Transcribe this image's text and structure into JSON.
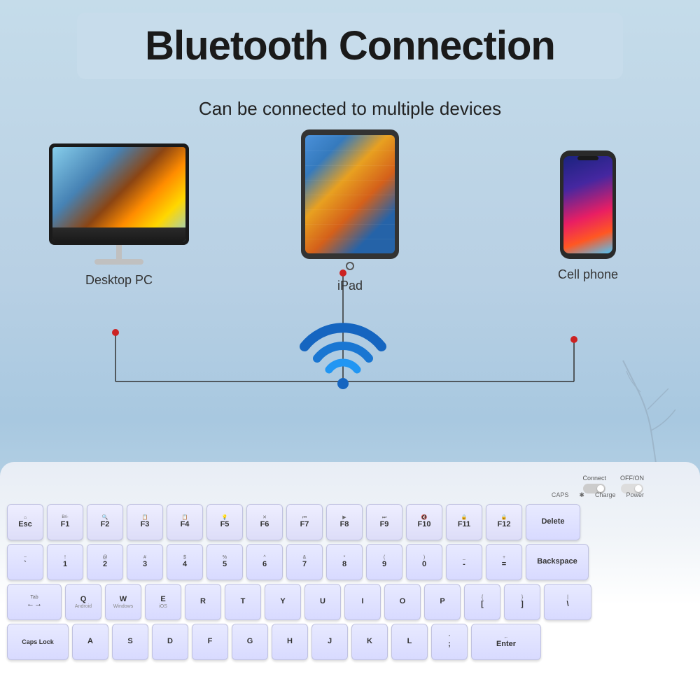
{
  "page": {
    "background_color": "#b8d4e8",
    "title": "Bluetooth Connection",
    "subtitle": "Can be connected to multiple devices"
  },
  "devices": [
    {
      "id": "desktop",
      "label": "Desktop PC"
    },
    {
      "id": "ipad",
      "label": "iPad"
    },
    {
      "id": "phone",
      "label": "Cell phone"
    }
  ],
  "indicators": {
    "connect_label": "Connect",
    "offon_label": "OFF/ON",
    "caps_label": "CAPS",
    "bt_label": "✱",
    "charge_label": "Charge",
    "power_label": "Power"
  },
  "keyboard": {
    "row1": [
      {
        "top": "⌂",
        "main": "Esc",
        "sub": ""
      },
      {
        "top": "Bri-",
        "main": "F1",
        "sub": ""
      },
      {
        "top": "🔍",
        "main": "F2",
        "sub": ""
      },
      {
        "top": "📋",
        "main": "F3",
        "sub": ""
      },
      {
        "top": "📋",
        "main": "F4",
        "sub": ""
      },
      {
        "top": "💡",
        "main": "F5",
        "sub": ""
      },
      {
        "top": "✕",
        "main": "F6",
        "sub": ""
      },
      {
        "top": "⏮",
        "main": "F7",
        "sub": ""
      },
      {
        "top": "▶",
        "main": "F8",
        "sub": ""
      },
      {
        "top": "⏭",
        "main": "F9",
        "sub": ""
      },
      {
        "top": "🔇",
        "main": "F10",
        "sub": ""
      },
      {
        "top": "🔒",
        "main": "F11",
        "sub": ""
      },
      {
        "top": "🔒",
        "main": "F12",
        "sub": ""
      },
      {
        "top": "",
        "main": "Delete",
        "sub": ""
      }
    ],
    "row2": [
      {
        "top": "~",
        "main": "1",
        "sub": ""
      },
      {
        "top": "@",
        "main": "2",
        "sub": ""
      },
      {
        "top": "#",
        "main": "3",
        "sub": ""
      },
      {
        "top": "$",
        "main": "4",
        "sub": ""
      },
      {
        "top": "%",
        "main": "5",
        "sub": ""
      },
      {
        "top": "^",
        "main": "6",
        "sub": ""
      },
      {
        "top": "&",
        "main": "7",
        "sub": ""
      },
      {
        "top": "*",
        "main": "8",
        "sub": ""
      },
      {
        "top": "(",
        "main": "9",
        "sub": ""
      },
      {
        "top": ")",
        "main": "0",
        "sub": ""
      },
      {
        "top": "_",
        "main": "-",
        "sub": ""
      },
      {
        "top": "+",
        "main": "=",
        "sub": ""
      },
      {
        "top": "",
        "main": "Backspace",
        "sub": ""
      }
    ],
    "row3": [
      {
        "top": "Tab",
        "main": "←→",
        "sub": ""
      },
      {
        "top": "",
        "main": "Q",
        "sub": "Android"
      },
      {
        "top": "",
        "main": "W",
        "sub": "Windows"
      },
      {
        "top": "",
        "main": "E",
        "sub": "iOS"
      },
      {
        "top": "",
        "main": "R",
        "sub": ""
      },
      {
        "top": "",
        "main": "T",
        "sub": ""
      },
      {
        "top": "",
        "main": "Y",
        "sub": ""
      },
      {
        "top": "",
        "main": "U",
        "sub": ""
      },
      {
        "top": "",
        "main": "I",
        "sub": ""
      },
      {
        "top": "",
        "main": "O",
        "sub": ""
      },
      {
        "top": "",
        "main": "P",
        "sub": ""
      },
      {
        "top": "{",
        "main": "[",
        "sub": ""
      },
      {
        "top": "}",
        "main": "]",
        "sub": ""
      },
      {
        "top": "",
        "main": "\\",
        "sub": ""
      }
    ],
    "row4": [
      {
        "top": "",
        "main": "Caps Lock",
        "sub": ""
      },
      {
        "top": "",
        "main": "A",
        "sub": ""
      },
      {
        "top": "",
        "main": "S",
        "sub": ""
      },
      {
        "top": "",
        "main": "D",
        "sub": ""
      },
      {
        "top": "",
        "main": "F",
        "sub": ""
      },
      {
        "top": "",
        "main": "G",
        "sub": ""
      },
      {
        "top": "",
        "main": "H",
        "sub": ""
      },
      {
        "top": "",
        "main": "J",
        "sub": ""
      },
      {
        "top": "",
        "main": "K",
        "sub": ""
      },
      {
        "top": "",
        "main": "L",
        "sub": ""
      },
      {
        "top": "",
        "main": ";",
        "sub": "\""
      },
      {
        "top": "",
        "main": "Enter",
        "sub": ""
      }
    ]
  }
}
